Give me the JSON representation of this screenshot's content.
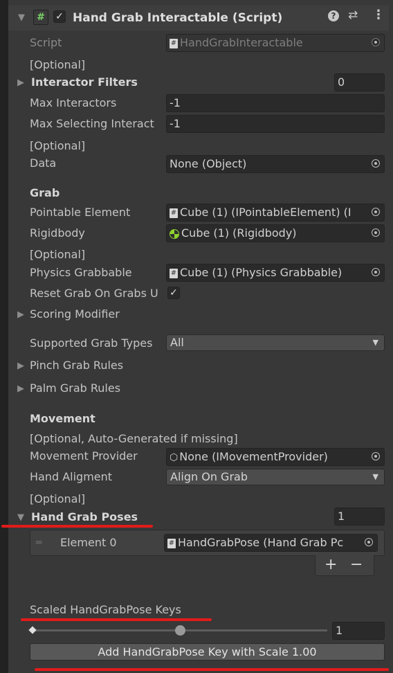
{
  "component": {
    "title": "Hand Grab Interactable (Script)",
    "icons": [
      "help-icon",
      "presets-icon",
      "kebab-menu-icon"
    ]
  },
  "fields": {
    "script": {
      "label": "Script",
      "value": "HandGrabInteractable"
    },
    "optional1": "[Optional]",
    "interactor_filters": {
      "label": "Interactor Filters",
      "count": "0"
    },
    "max_interactors": {
      "label": "Max Interactors",
      "value": "-1"
    },
    "max_selecting": {
      "label": "Max Selecting Interact",
      "value": "-1"
    },
    "optional2": "[Optional]",
    "data": {
      "label": "Data",
      "value": "None (Object)"
    },
    "grab_header": "Grab",
    "pointable_element": {
      "label": "Pointable Element",
      "value": "Cube (1) (IPointableElement) (I"
    },
    "rigidbody": {
      "label": "Rigidbody",
      "value": "Cube (1) (Rigidbody)"
    },
    "optional3": "[Optional]",
    "physics_grabbable": {
      "label": "Physics Grabbable",
      "value": "Cube (1) (Physics Grabbable)"
    },
    "reset_grab": {
      "label": "Reset Grab On Grabs U",
      "checked": true
    },
    "scoring_modifier": {
      "label": "Scoring Modifier"
    },
    "supported_grab_types": {
      "label": "Supported Grab Types",
      "value": "All"
    },
    "pinch_grab_rules": {
      "label": "Pinch Grab Rules"
    },
    "palm_grab_rules": {
      "label": "Palm Grab Rules"
    },
    "movement_header": "Movement",
    "optional_auto": "[Optional, Auto-Generated if missing]",
    "movement_provider": {
      "label": "Movement Provider",
      "value": "None (IMovementProvider)"
    },
    "hand_aligment": {
      "label": "Hand Aligment",
      "value": "Align On Grab"
    },
    "optional4": "[Optional]",
    "hand_grab_poses": {
      "label": "Hand Grab Poses",
      "count": "1",
      "elements": [
        {
          "label": "Element 0",
          "value": "HandGrabPose (Hand Grab Pc"
        }
      ],
      "add_label": "+",
      "remove_label": "−"
    },
    "scaled_keys": {
      "label": "Scaled HandGrabPose Keys",
      "slider_value": "1",
      "slider_fraction": 0.5
    },
    "add_key_button": "Add HandGrabPose Key with Scale 1.00"
  },
  "colors": {
    "annotation_red": "#e21b1b",
    "background": "#383838",
    "field": "#2a2a2a"
  }
}
